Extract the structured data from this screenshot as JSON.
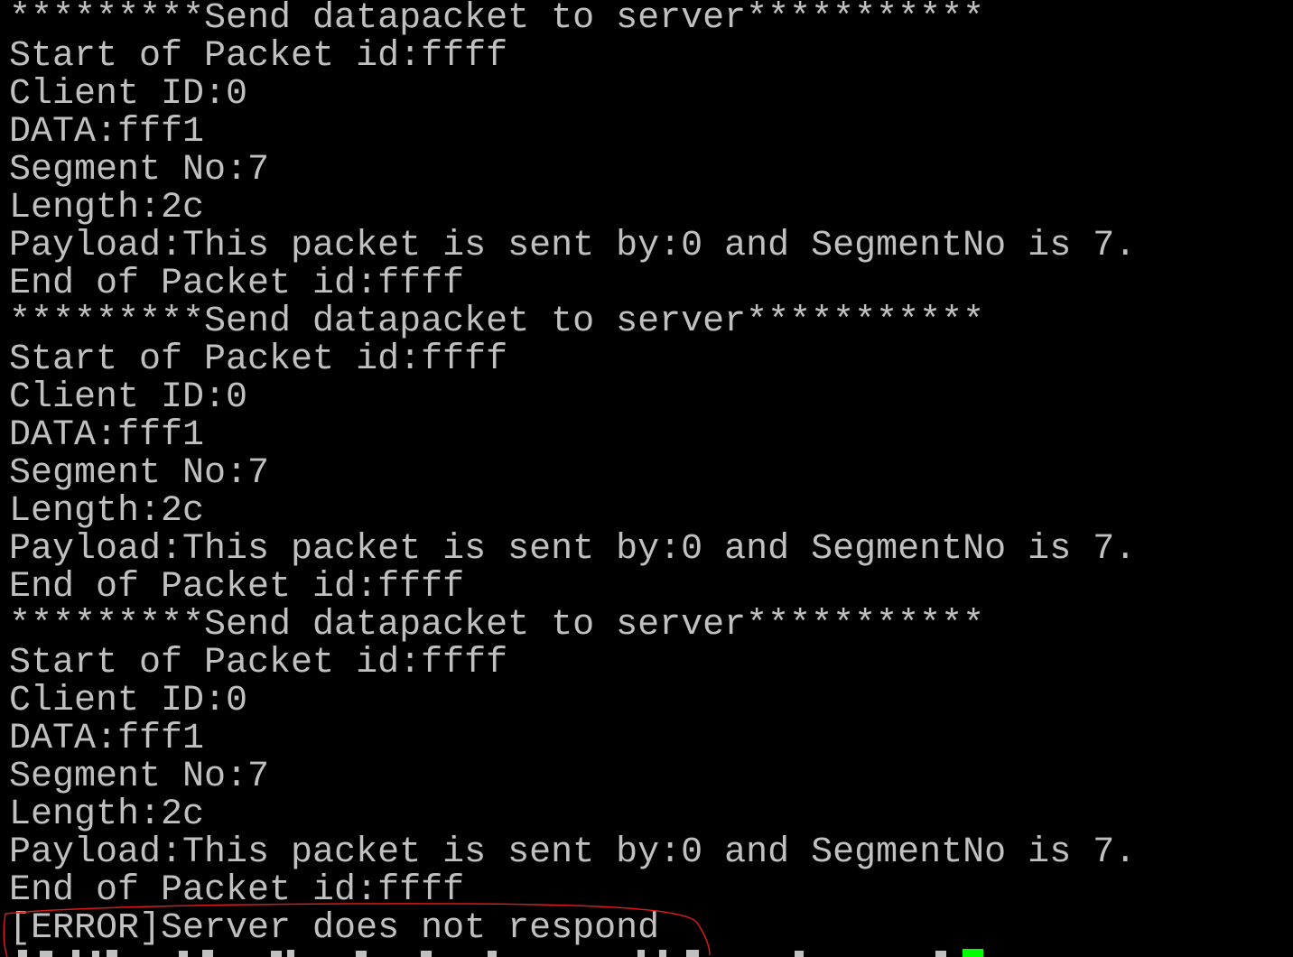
{
  "terminal": {
    "lines": [
      "*********Send datapacket to server***********",
      "Start of Packet id:ffff",
      "Client ID:0",
      "DATA:fff1",
      "Segment No:7",
      "Length:2c",
      "Payload:This packet is sent by:0 and SegmentNo is 7.",
      "End of Packet id:ffff",
      "*********Send datapacket to server***********",
      "Start of Packet id:ffff",
      "Client ID:0",
      "DATA:fff1",
      "Segment No:7",
      "Length:2c",
      "Payload:This packet is sent by:0 and SegmentNo is 7.",
      "End of Packet id:ffff",
      "*********Send datapacket to server***********",
      "Start of Packet id:ffff",
      "Client ID:0",
      "DATA:fff1",
      "Segment No:7",
      "Length:2c",
      "Payload:This packet is sent by:0 and SegmentNo is 7.",
      "End of Packet id:ffff",
      "[ERROR]Server does not respond"
    ],
    "text_color": "#c0c0c0",
    "background_color": "#000000",
    "cursor_color": "#00ff00",
    "annotation_color": "#d81b1b"
  }
}
